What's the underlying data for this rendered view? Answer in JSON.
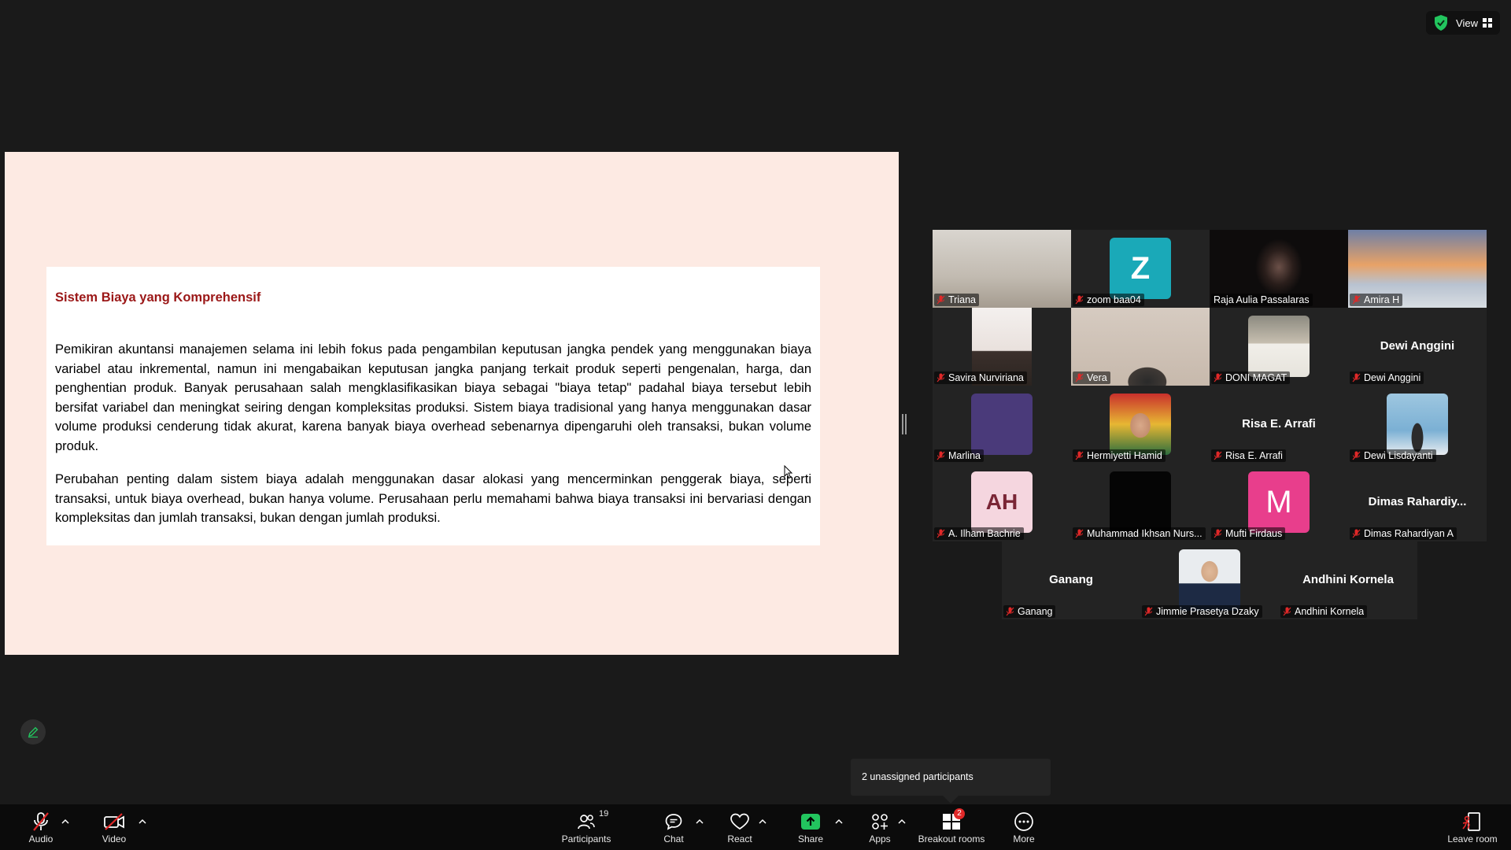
{
  "top_bar": {
    "security_icon": "shield-check-icon",
    "view_label": "View",
    "view_icon": "grid-icon",
    "accent_green": "#25d366"
  },
  "shared_screen": {
    "title": "Sistem Biaya yang Komprehensif",
    "paragraphs": [
      "Pemikiran akuntansi manajemen selama ini lebih fokus pada pengambilan keputusan jangka pendek yang menggunakan biaya variabel atau inkremental, namun ini mengabaikan keputusan jangka panjang terkait produk seperti pengenalan, harga, dan penghentian produk. Banyak perusahaan salah mengklasifikasikan biaya sebagai \"biaya tetap\" padahal biaya tersebut lebih bersifat variabel dan meningkat seiring dengan kompleksitas produksi. Sistem biaya tradisional yang hanya menggunakan dasar volume produksi cenderung tidak akurat, karena banyak biaya overhead sebenarnya dipengaruhi oleh transaksi, bukan volume produk.",
      "Perubahan penting dalam sistem biaya adalah menggunakan dasar alokasi yang mencerminkan penggerak biaya, seperti transaksi, untuk biaya overhead, bukan hanya volume. Perusahaan perlu memahami bahwa biaya transaksi ini bervariasi dengan kompleksitas dan jumlah transaksi, bukan dengan jumlah produksi."
    ],
    "background_color": "#fdeae3",
    "title_color": "#9b1717"
  },
  "participants": [
    {
      "name": "Triana",
      "muted": true,
      "tile": "video"
    },
    {
      "name": "zoom baa04",
      "muted": true,
      "tile": "avatar",
      "initials": "Z",
      "avatar_color": "#1aa9b8"
    },
    {
      "name": "Raja Aulia Passalaras",
      "muted": false,
      "tile": "video",
      "active_speaker": true
    },
    {
      "name": "Amira H",
      "muted": true,
      "tile": "video"
    },
    {
      "name": "Savira Nurviriana",
      "muted": true,
      "tile": "video"
    },
    {
      "name": "Vera",
      "muted": true,
      "tile": "video"
    },
    {
      "name": "DONI MAGAT",
      "muted": true,
      "tile": "photo"
    },
    {
      "name": "Dewi Anggini",
      "muted": true,
      "tile": "name",
      "display": "Dewi Anggini"
    },
    {
      "name": "Marlina",
      "muted": true,
      "tile": "avatar",
      "initials": "",
      "avatar_color": "#4a3a7a"
    },
    {
      "name": "Hermiyetti Hamid",
      "muted": true,
      "tile": "photo"
    },
    {
      "name": "Risa E. Arrafi",
      "muted": true,
      "tile": "name",
      "display": "Risa E. Arrafi"
    },
    {
      "name": "Dewi Lisdayanti",
      "muted": true,
      "tile": "photo"
    },
    {
      "name": "A. Ilham Bachrie",
      "muted": true,
      "tile": "avatar",
      "initials": "AH",
      "avatar_color": "#f5d6df",
      "initials_color": "#7a2636"
    },
    {
      "name": "Muhammad Ikhsan Nurs...",
      "muted": true,
      "tile": "avatar",
      "initials": "",
      "avatar_color": "#050505"
    },
    {
      "name": "Mufti Firdaus",
      "muted": true,
      "tile": "avatar",
      "initials": "M",
      "avatar_color": "#e83e8c"
    },
    {
      "name": "Dimas Rahardiyan A",
      "muted": true,
      "tile": "name",
      "display": "Dimas  Rahardiy..."
    },
    {
      "name": "Ganang",
      "muted": true,
      "tile": "name",
      "display": "Ganang"
    },
    {
      "name": "Jimmie Prasetya Dzaky",
      "muted": true,
      "tile": "photo"
    },
    {
      "name": "Andhini Kornela",
      "muted": true,
      "tile": "name",
      "display": "Andhini Kornela"
    }
  ],
  "notification": {
    "text": "2 unassigned participants"
  },
  "annotate": {
    "icon": "pencil-icon"
  },
  "toolbar": {
    "audio": {
      "label": "Audio",
      "icon": "mic-muted-icon"
    },
    "video": {
      "label": "Video",
      "icon": "camera-off-icon"
    },
    "participants": {
      "label": "Participants",
      "icon": "people-icon",
      "count": "19"
    },
    "chat": {
      "label": "Chat",
      "icon": "chat-icon"
    },
    "react": {
      "label": "React",
      "icon": "heart-icon"
    },
    "share": {
      "label": "Share",
      "icon": "share-arrow-icon",
      "color": "#22c55e"
    },
    "apps": {
      "label": "Apps",
      "icon": "apps-icon"
    },
    "breakout": {
      "label": "Breakout rooms",
      "icon": "breakout-icon",
      "badge": "2"
    },
    "more": {
      "label": "More",
      "icon": "more-icon"
    },
    "leave": {
      "label": "Leave room",
      "icon": "leave-icon",
      "color": "#e02828"
    }
  }
}
